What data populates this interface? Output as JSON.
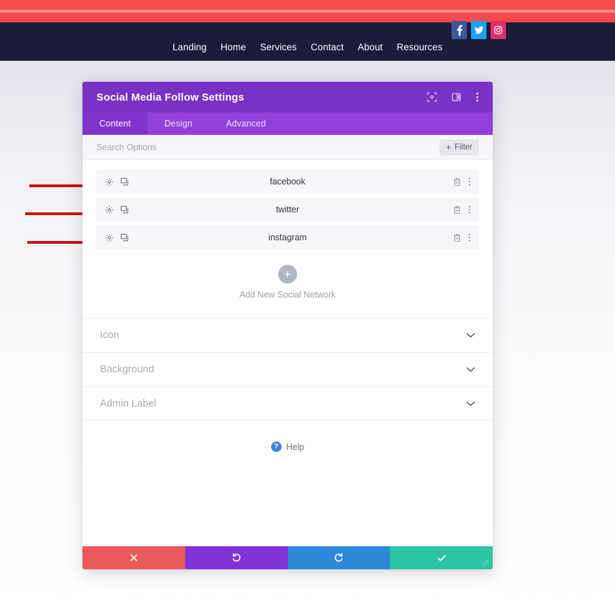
{
  "site": {
    "topbar_color": "#fb4a4a",
    "navbar_color": "#1c1b3a",
    "nav_links": [
      {
        "label": "Landing"
      },
      {
        "label": "Home"
      },
      {
        "label": "Services"
      },
      {
        "label": "Contact"
      },
      {
        "label": "About"
      },
      {
        "label": "Resources"
      }
    ],
    "social_icons": [
      {
        "name": "facebook-icon",
        "color": "#3b5998"
      },
      {
        "name": "twitter-icon",
        "color": "#1da1f2"
      },
      {
        "name": "instagram-icon",
        "color": "#e1306c"
      }
    ]
  },
  "modal": {
    "title": "Social Media Follow Settings",
    "header_color": "#7a32c4",
    "header_icons": [
      {
        "name": "target-icon"
      },
      {
        "name": "layout-panel-icon"
      },
      {
        "name": "more-vertical-icon"
      }
    ],
    "tabs": [
      {
        "label": "Content",
        "active": true
      },
      {
        "label": "Design",
        "active": false
      },
      {
        "label": "Advanced",
        "active": false
      }
    ],
    "search": {
      "placeholder": "Search Options",
      "value": ""
    },
    "filter_button": {
      "label": "Filter",
      "plus": "+"
    },
    "networks": [
      {
        "label": "facebook"
      },
      {
        "label": "twitter"
      },
      {
        "label": "instagram"
      }
    ],
    "row_icons": {
      "settings": "gear-icon",
      "duplicate": "duplicate-icon",
      "delete": "trash-icon",
      "more": "more-vertical-icon"
    },
    "add_new": {
      "plus": "+",
      "label": "Add New Social Network"
    },
    "sections": [
      {
        "label": "Icon"
      },
      {
        "label": "Background"
      },
      {
        "label": "Admin Label"
      }
    ],
    "help": {
      "badge": "?",
      "label": "Help"
    },
    "footer_buttons": [
      {
        "name": "cancel-button",
        "icon": "close-icon",
        "color": "#ea5a5a"
      },
      {
        "name": "undo-button",
        "icon": "undo-icon",
        "color": "#8233d8"
      },
      {
        "name": "redo-button",
        "icon": "redo-icon",
        "color": "#2e8ad8"
      },
      {
        "name": "save-button",
        "icon": "check-icon",
        "color": "#2ec5a4"
      }
    ]
  },
  "annotations": {
    "arrow_color": "#cc1111",
    "arrows": [
      {
        "target": "facebook"
      },
      {
        "target": "twitter"
      },
      {
        "target": "instagram"
      }
    ]
  }
}
